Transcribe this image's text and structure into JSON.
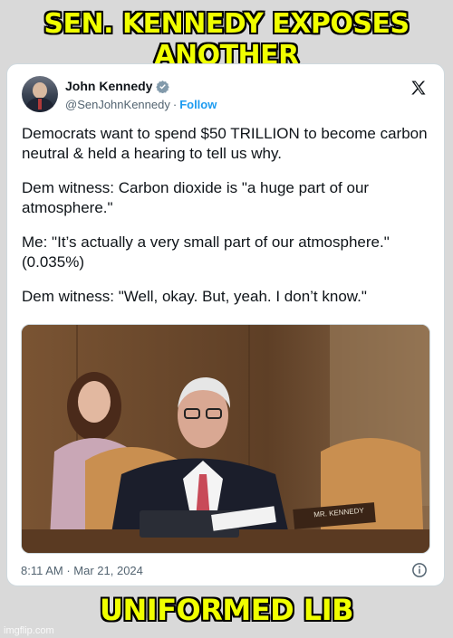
{
  "meme": {
    "top_caption": "SEN. KENNEDY EXPOSES ANOTHER",
    "bottom_caption": "UNIFORMED LIB",
    "watermark": "imgflip.com",
    "caption_color": "#f0ff00"
  },
  "tweet": {
    "author_name": "John Kennedy",
    "handle": "@SenJohnKennedy",
    "separator": "·",
    "follow_label": "Follow",
    "paragraphs": [
      "Democrats want to spend $50 TRILLION to become carbon neutral & held a hearing to tell us why.",
      "Dem witness: Carbon dioxide is \"a huge part of our atmosphere.\"",
      "Me: \"It’s actually a very small part of our atmosphere.\" (0.035%)",
      "Dem witness: \"Well, okay. But, yeah. I don’t know.\""
    ],
    "nameplate": "MR. KENNEDY",
    "timestamp": "8:11 AM · Mar 21, 2024",
    "icons": [
      "verified-badge-icon",
      "x-logo-icon",
      "info-icon"
    ],
    "accent_color": "#1d9bf0"
  }
}
